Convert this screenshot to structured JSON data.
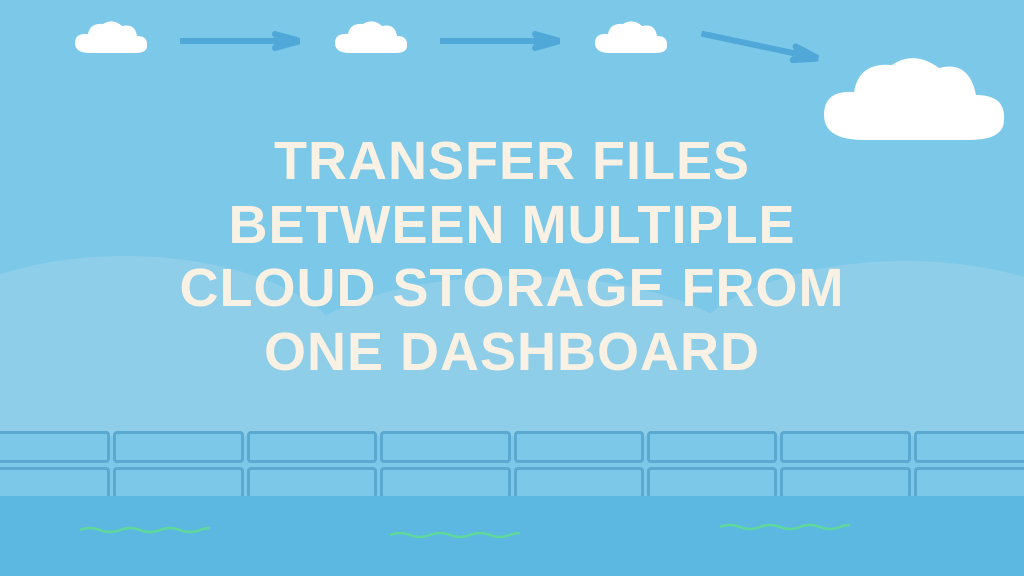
{
  "headline": {
    "line1": "TRANSFER FILES",
    "line2": "BETWEEN MULTIPLE",
    "line3": "CLOUD STORAGE FROM",
    "line4": "ONE DASHBOARD"
  },
  "colors": {
    "sky": "#7BC8E8",
    "cloud": "#FFFFFF",
    "arrow": "#4FA8D8",
    "text": "#F9F1E3",
    "water": "#5CB8E0",
    "wave": "#5FD89C"
  }
}
